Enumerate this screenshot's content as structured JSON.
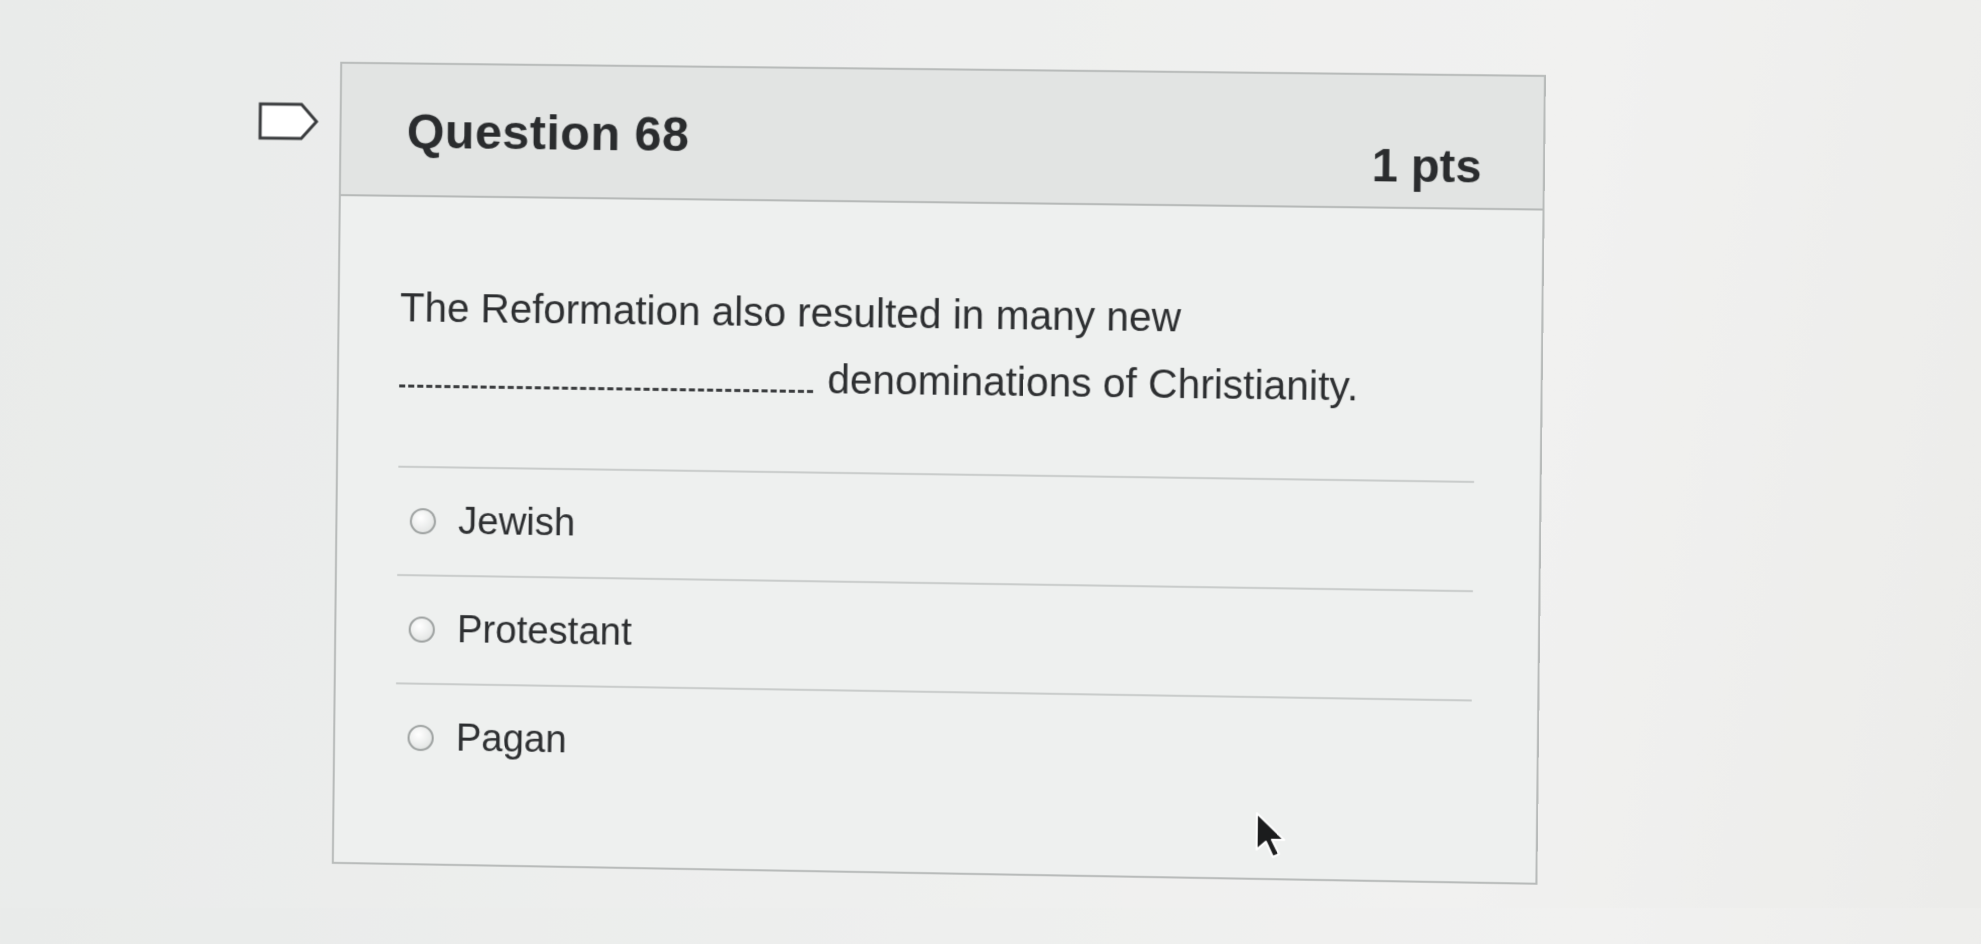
{
  "question": {
    "title": "Question 68",
    "points": "1 pts",
    "text_before": "The Reformation also resulted in many new",
    "text_after": "denominations of Christianity."
  },
  "answers": [
    {
      "label": "Jewish"
    },
    {
      "label": "Protestant"
    },
    {
      "label": "Pagan"
    }
  ],
  "icons": {
    "flag": "bookmark-flag-icon",
    "cursor": "mouse-pointer-icon"
  },
  "colors": {
    "header_bg": "#e2e4e3",
    "card_bg": "#eef0ef",
    "text": "#2d2f31",
    "border": "#b8bbba"
  }
}
